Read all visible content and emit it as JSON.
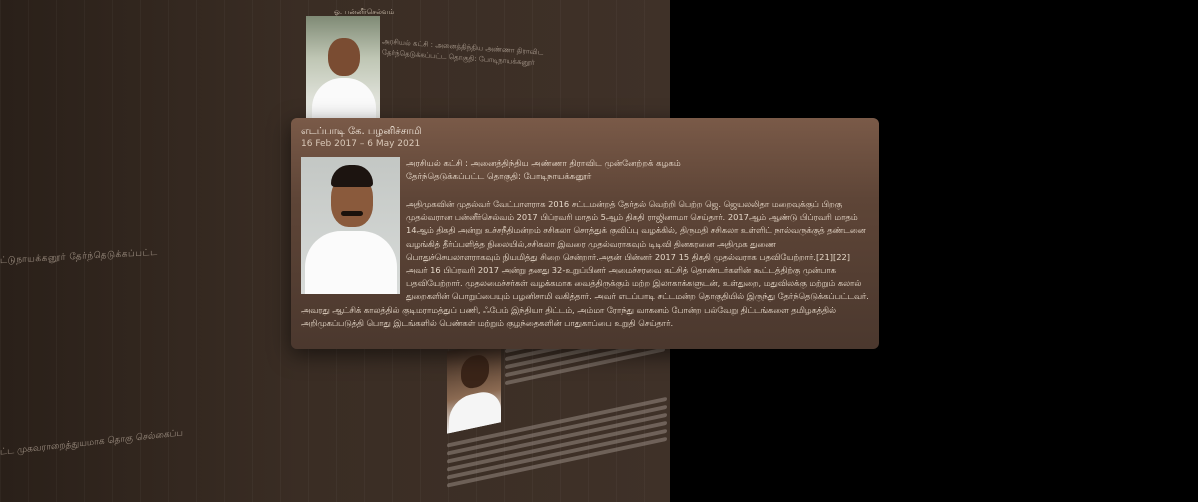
{
  "popup": {
    "name": "எடப்பாடி கே. பழனிச்சாமி",
    "dates": "16 Feb 2017 – 6 May 2021",
    "party": "அரசியல் கட்சி : அனைத்திந்திய அண்ணா திராவிட முன்னேற்றக் கழகம்",
    "constituency": "தேர்ந்தெடுக்கப்பட்ட தொகுதி: போடிநாயக்கனூர்",
    "description": "அதிமுகவின் முதல்வர் வேட்பாளராக 2016 சட்டமன்றத் தேர்தல் வெற்றி பெற்ற ஜெ. ஜெயலலிதா மறைவுக்குப் பிறகு முதல்வரான பன்னீர்செல்வம் 2017 பிப்ரவரி மாதம் 5ஆம் திகதி ராஜினாமா செய்தார். 2017ஆம் ஆண்டு பிப்ரவரி மாதம் 14ஆம் திகதி அன்று உச்சநீதிமன்றம் சசிகலா சொத்துக் குவிப்பு வழக்கில், திருமதி சசிகலா உள்ளிட் நால்வருக்குத் தண்டனை வழங்கித் தீர்ப்பளித்த நிலையில்,சசிகலா இவரை முதல்வராகவும் டிடிவி தினகரனை அதிமுக துணை பொதுச்செயலாளராகவும் நியமித்து சிறை சென்றார்.அதன் பின்னர் 2017 15 திகதி முதல்வராக பதவியேற்றார்.[21][22] அவர் 16 பிப்ரவரி 2017 அன்று தனது 32-உறுப்பினர் அமைச்சரவை கட்சித் தொண்டர்களின் கூட்டத்திற்கு முன்பாக பதவியேற்றார். முதலமைச்சர்கள் வழக்கமாக வைத்திருக்கும் மற்ற இலாகாக்களுடன், உள்துறை, மதுவிலக்கு மற்றும் கலால் துறைகளின் பொறுப்பையும் பழனிசாமி வகித்தார். அவர் எடப்பாடி சட்டமன்ற தொகுதியில் இருந்து தேர்ந்தெடுக்கப்பட்டவர். அவரது ஆட்சிக் காலத்தில் குடிமராமத்துப் பணி, ஃபேம் இந்தியா திட்டம், அம்மா ரோந்து வாகனம் போன்ற பல்வேறு திட்டங்களை தமிழகத்தில் அறிமுகப்படுத்தி பொது இடங்களில் பெண்கள் மற்றும் குழந்தைகளின் பாதுகாப்பை உறுதி செய்தார்."
  },
  "background": {
    "wall_text_1": "ட்டுநாயக்கனூர் தேர்ந்தெடுக்கப்பட்ட",
    "wall_text_2": "ட்ட முகவராறைத்துயமாக தொகு செல்கைப்ப",
    "top_card_title": "ஓ. பன்னீர்செல்வம்",
    "top_card_lines": [
      "அரசியல் கட்சி : அனைத்திந்திய அண்ணா திராவிட",
      "தேர்ந்தெடுக்கப்பட்ட தொகுதி: போடிநாயக்கனூர்"
    ]
  }
}
